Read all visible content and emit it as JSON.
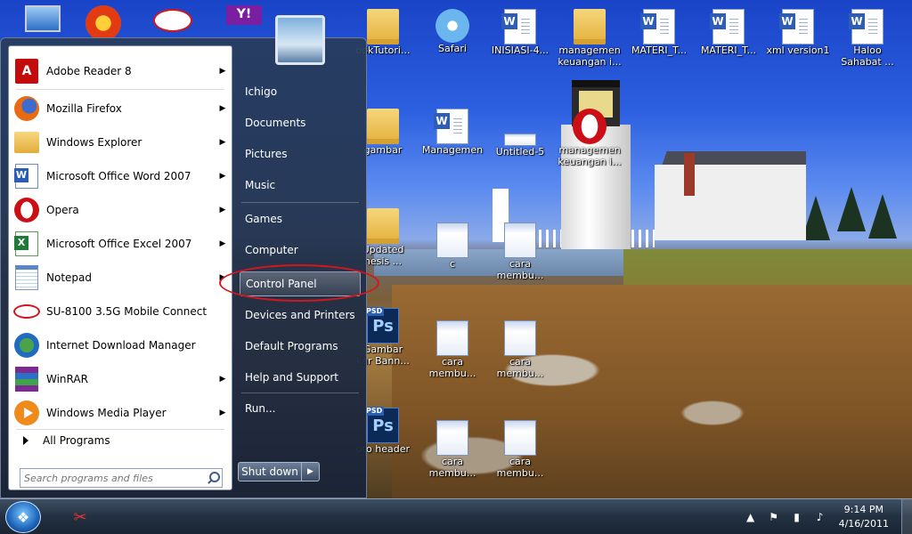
{
  "desktop": {
    "icons": [
      {
        "label": "Safari",
        "icon": "safari-icon"
      },
      {
        "label": "INISIASI-4...",
        "icon": "word-doc-icon"
      },
      {
        "label": "managemen\nkeuangan i...",
        "icon": "folder-icon"
      },
      {
        "label": "MATERI_T...",
        "icon": "word-doc-icon"
      },
      {
        "label": "MATERI_T...",
        "icon": "word-doc-icon"
      },
      {
        "label": "xml version1",
        "icon": "word-doc-icon"
      },
      {
        "label": "Haloo\nSahabat ...",
        "icon": "word-doc-icon"
      },
      {
        "label": "ookTutori...",
        "icon": "folder-icon"
      },
      {
        "label": "gambar",
        "icon": "folder-icon"
      },
      {
        "label": "Managemen",
        "icon": "word-doc-icon"
      },
      {
        "label": "Untitled-5",
        "icon": "screenshot-icon"
      },
      {
        "label": "managemen\nkeuangan i...",
        "icon": "opera-icon"
      },
      {
        "label": "Updated\nhesis ...",
        "icon": "folder-icon"
      },
      {
        "label": "c",
        "icon": "screenshot-icon"
      },
      {
        "label": "cara\nmembu...",
        "icon": "screenshot-icon"
      },
      {
        "label": "Gambar\nkar Bann...",
        "icon": "psd-icon"
      },
      {
        "label": "cara\nmembu...",
        "icon": "screenshot-icon"
      },
      {
        "label": "cara\nmembu...",
        "icon": "screenshot-icon"
      },
      {
        "label": "oto header",
        "icon": "psd-icon"
      },
      {
        "label": "cara\nmembu...",
        "icon": "screenshot-icon"
      },
      {
        "label": "cara\nmembu...",
        "icon": "screenshot-icon"
      }
    ]
  },
  "start_menu": {
    "programs": [
      {
        "label": "Adobe Reader 8",
        "icon": "adobe-reader-icon",
        "has_submenu": true
      },
      {
        "label": "Mozilla Firefox",
        "icon": "firefox-icon",
        "has_submenu": true
      },
      {
        "label": "Windows Explorer",
        "icon": "windows-explorer-icon",
        "has_submenu": true
      },
      {
        "label": "Microsoft Office Word 2007",
        "icon": "word-icon",
        "has_submenu": true
      },
      {
        "label": "Opera",
        "icon": "opera-icon",
        "has_submenu": true
      },
      {
        "label": "Microsoft Office Excel 2007",
        "icon": "excel-icon",
        "has_submenu": true
      },
      {
        "label": "Notepad",
        "icon": "notepad-icon",
        "has_submenu": true
      },
      {
        "label": "SU-8100 3.5G Mobile Connect",
        "icon": "mobile-connect-icon",
        "has_submenu": false
      },
      {
        "label": "Internet Download Manager",
        "icon": "idm-icon",
        "has_submenu": false
      },
      {
        "label": "WinRAR",
        "icon": "winrar-icon",
        "has_submenu": true
      },
      {
        "label": "Windows Media Player",
        "icon": "media-player-icon",
        "has_submenu": true
      }
    ],
    "all_programs": "All Programs",
    "search_placeholder": "Search programs and files",
    "right_items": [
      "Ichigo",
      "Documents",
      "Pictures",
      "Music",
      "Games",
      "Computer",
      "Control Panel",
      "Devices and Printers",
      "Default Programs",
      "Help and Support",
      "Run..."
    ],
    "highlighted_item": "Control Panel",
    "shutdown_label": "Shut down"
  },
  "taskbar": {
    "clock_time": "9:14 PM",
    "clock_date": "4/16/2011"
  },
  "colors": {
    "annotation_red": "#d8141c",
    "taskbar": "#223041"
  }
}
